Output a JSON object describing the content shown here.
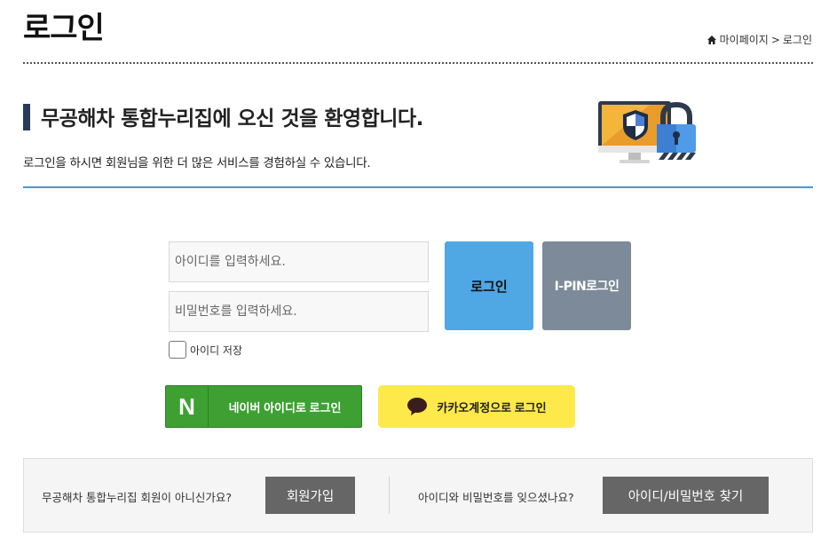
{
  "header": {
    "title": "로그인",
    "breadcrumb": [
      "마이페이지",
      "로그인"
    ],
    "breadcrumb_separator": ">"
  },
  "welcome": {
    "title": "무공해차 통합누리집에 오신 것을 환영합니다.",
    "description": "로그인을 하시면 회원님을 위한 더 많은 서비스를 경험하실 수 있습니다."
  },
  "form": {
    "id_placeholder": "아이디를 입력하세요.",
    "password_placeholder": "비밀번호를 입력하세요.",
    "login_label": "로그인",
    "ipin_label": "I-PIN로그인",
    "remember_label": "아이디 저장",
    "remember_checked": false
  },
  "social": {
    "naver_logo": "N",
    "naver_label": "네이버 아이디로 로그인",
    "kakao_label": "카카오계정으로 로그인"
  },
  "footer": {
    "join_question": "무공해차 통합누리집 회원이 아니신가요?",
    "join_label": "회원가입",
    "find_question": "아이디와 비밀번호를 잊으셨나요?",
    "find_label": "아이디/비밀번호 찾기"
  },
  "colors": {
    "accent_blue": "#4fa7e4",
    "ipin_gray": "#7c8a99",
    "naver_green": "#3ea033",
    "kakao_yellow": "#fde94a",
    "title_bar": "#2a3a5a",
    "rule_blue": "#4a97d2"
  },
  "icons": {
    "breadcrumb_home": "home-icon",
    "illustration": "security-monitor-lock-icon",
    "kakao": "speech-bubble-icon"
  }
}
